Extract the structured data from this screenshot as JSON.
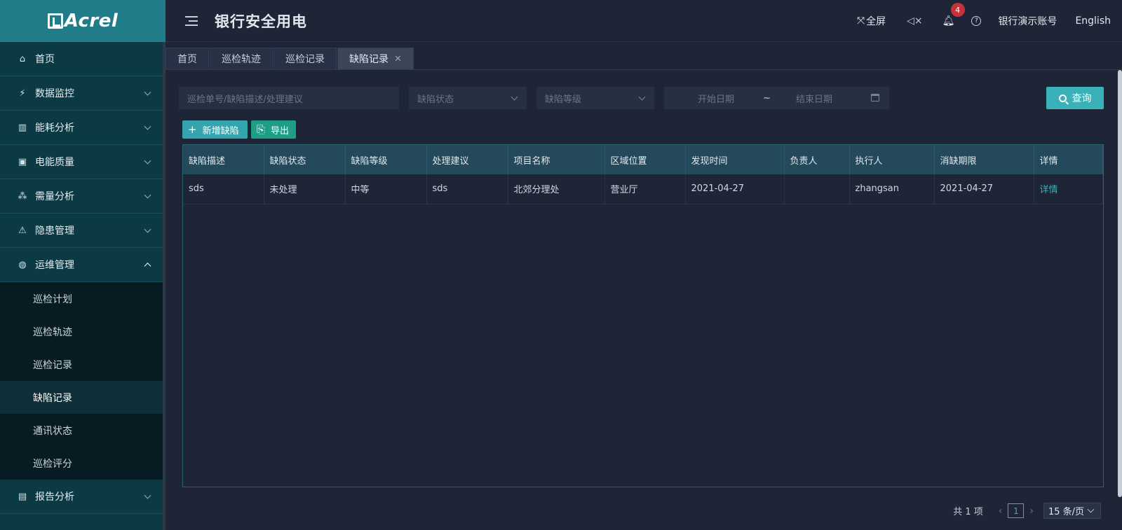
{
  "app": {
    "logo_text": "Acrel",
    "title": "银行安全用电"
  },
  "header": {
    "fullscreen_label": "全屏",
    "notification_count": "4",
    "help_icon": "?",
    "account_name": "银行演示账号",
    "language": "English"
  },
  "sidebar": {
    "items": [
      {
        "label": "首页",
        "icon": "home-icon",
        "glyph": "⌂"
      },
      {
        "label": "数据监控",
        "icon": "monitor-icon",
        "glyph": "⚡"
      },
      {
        "label": "能耗分析",
        "icon": "bar-chart-icon",
        "glyph": "▥"
      },
      {
        "label": "电能质量",
        "icon": "battery-icon",
        "glyph": "▣"
      },
      {
        "label": "需量分析",
        "icon": "cluster-icon",
        "glyph": "⁂"
      },
      {
        "label": "隐患管理",
        "icon": "warning-icon",
        "glyph": "⚠"
      },
      {
        "label": "运维管理",
        "icon": "globe-icon",
        "glyph": "◍"
      }
    ],
    "subitems": [
      {
        "label": "巡检计划"
      },
      {
        "label": "巡检轨迹"
      },
      {
        "label": "巡检记录"
      },
      {
        "label": "缺陷记录"
      },
      {
        "label": "通讯状态"
      },
      {
        "label": "巡检评分"
      }
    ],
    "bottom_item": {
      "label": "报告分析",
      "icon": "report-icon",
      "glyph": "▤"
    }
  },
  "tabs": [
    {
      "label": "首页"
    },
    {
      "label": "巡检轨迹"
    },
    {
      "label": "巡检记录"
    },
    {
      "label": "缺陷记录"
    }
  ],
  "filters": {
    "keyword_placeholder": "巡检单号/缺陷描述/处理建议",
    "status_placeholder": "缺陷状态",
    "level_placeholder": "缺陷等级",
    "start_date_placeholder": "开始日期",
    "range_separator": "~",
    "end_date_placeholder": "结束日期",
    "query_label": "查询"
  },
  "actions": {
    "add_label": "新增缺陷",
    "export_label": "导出"
  },
  "table": {
    "columns": [
      "缺陷描述",
      "缺陷状态",
      "缺陷等级",
      "处理建议",
      "项目名称",
      "区域位置",
      "发现时间",
      "负责人",
      "执行人",
      "消缺期限",
      "详情"
    ],
    "rows": [
      [
        "sds",
        "未处理",
        "中等",
        "sds",
        "北郊分理处",
        "营业厅",
        "2021-04-27",
        "",
        "zhangsan",
        "2021-04-27",
        "详情"
      ]
    ]
  },
  "pagination": {
    "total_label": "共 1 项",
    "current_page": "1",
    "page_size_label": "15 条/页"
  },
  "colors": {
    "accent": "#3ab1b8",
    "sidebar_bg": "#0b3a45",
    "logo_bg": "#1f7c88",
    "content_bg": "#1e2536",
    "badge": "#c7313c"
  }
}
